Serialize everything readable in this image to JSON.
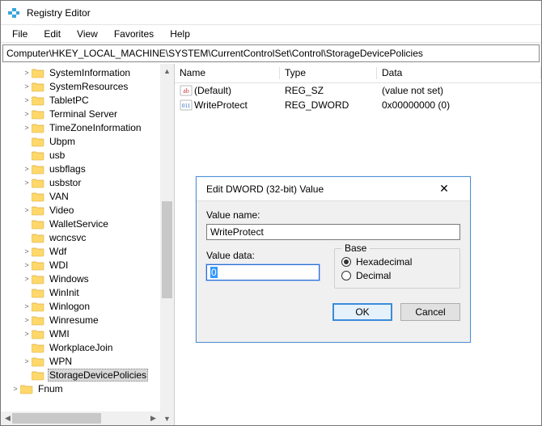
{
  "window": {
    "title": "Registry Editor"
  },
  "menu": {
    "items": [
      "File",
      "Edit",
      "View",
      "Favorites",
      "Help"
    ]
  },
  "addressbar": {
    "path": "Computer\\HKEY_LOCAL_MACHINE\\SYSTEM\\CurrentControlSet\\Control\\StorageDevicePolicies"
  },
  "tree": {
    "items": [
      {
        "label": "SystemInformation",
        "expander": ">",
        "depth": 1
      },
      {
        "label": "SystemResources",
        "expander": ">",
        "depth": 1
      },
      {
        "label": "TabletPC",
        "expander": ">",
        "depth": 1
      },
      {
        "label": "Terminal Server",
        "expander": ">",
        "depth": 1
      },
      {
        "label": "TimeZoneInformation",
        "expander": ">",
        "depth": 1
      },
      {
        "label": "Ubpm",
        "expander": "",
        "depth": 1
      },
      {
        "label": "usb",
        "expander": "",
        "depth": 1
      },
      {
        "label": "usbflags",
        "expander": ">",
        "depth": 1
      },
      {
        "label": "usbstor",
        "expander": ">",
        "depth": 1
      },
      {
        "label": "VAN",
        "expander": "",
        "depth": 1
      },
      {
        "label": "Video",
        "expander": ">",
        "depth": 1
      },
      {
        "label": "WalletService",
        "expander": "",
        "depth": 1
      },
      {
        "label": "wcncsvc",
        "expander": "",
        "depth": 1
      },
      {
        "label": "Wdf",
        "expander": ">",
        "depth": 1
      },
      {
        "label": "WDI",
        "expander": ">",
        "depth": 1
      },
      {
        "label": "Windows",
        "expander": ">",
        "depth": 1
      },
      {
        "label": "WinInit",
        "expander": "",
        "depth": 1
      },
      {
        "label": "Winlogon",
        "expander": ">",
        "depth": 1
      },
      {
        "label": "Winresume",
        "expander": ">",
        "depth": 1
      },
      {
        "label": "WMI",
        "expander": ">",
        "depth": 1
      },
      {
        "label": "WorkplaceJoin",
        "expander": "",
        "depth": 1
      },
      {
        "label": "WPN",
        "expander": ">",
        "depth": 1
      },
      {
        "label": "StorageDevicePolicies",
        "expander": "",
        "depth": 1,
        "selected": true
      },
      {
        "label": "Fnum",
        "expander": ">",
        "depth": 0
      }
    ]
  },
  "list": {
    "columns": {
      "name": "Name",
      "type": "Type",
      "data": "Data"
    },
    "rows": [
      {
        "icon": "ab",
        "name": "(Default)",
        "type": "REG_SZ",
        "data": "(value not set)"
      },
      {
        "icon": "110",
        "name": "WriteProtect",
        "type": "REG_DWORD",
        "data": "0x00000000 (0)"
      }
    ]
  },
  "dialog": {
    "title": "Edit DWORD (32-bit) Value",
    "valuename_label": "Value name:",
    "valuename": "WriteProtect",
    "valuedata_label": "Value data:",
    "valuedata": "0",
    "base_label": "Base",
    "radio_hex": "Hexadecimal",
    "radio_dec": "Decimal",
    "ok": "OK",
    "cancel": "Cancel"
  }
}
